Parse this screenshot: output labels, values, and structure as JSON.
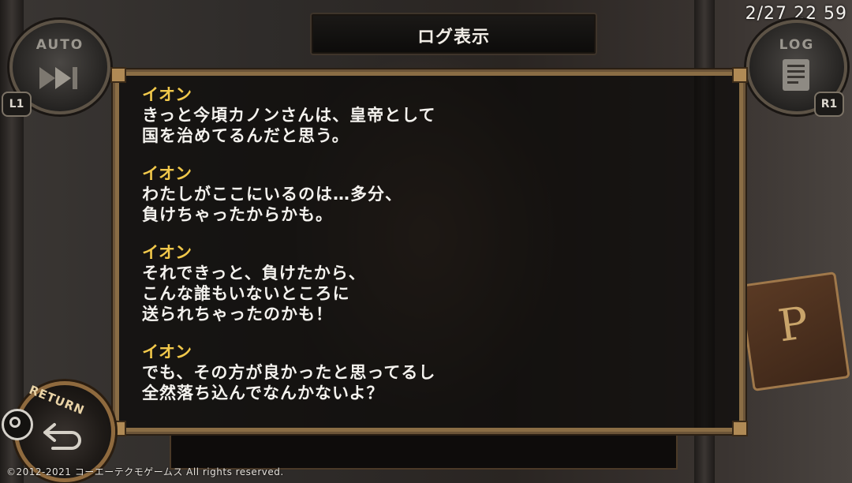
{
  "title": "ログ表示",
  "clock": "2/27 22 59",
  "buttons": {
    "auto_label": "AUTO",
    "auto_shoulder": "L1",
    "log_label": "LOG",
    "log_shoulder": "R1",
    "return_label": "RETURN"
  },
  "log_entries": [
    {
      "speaker": "イオン",
      "lines": [
        "きっと今頃カノンさんは、皇帝として",
        "国を治めてるんだと思う。"
      ]
    },
    {
      "speaker": "イオン",
      "lines": [
        "わたしがここにいるのは…多分、",
        "負けちゃったからかも。"
      ]
    },
    {
      "speaker": "イオン",
      "lines": [
        "それできっと、負けたから、",
        "こんな誰もいないところに",
        "送られちゃったのかも！"
      ]
    },
    {
      "speaker": "イオン",
      "lines": [
        "でも、その方が良かったと思ってるし",
        "全然落ち込んでなんかないよ？"
      ]
    }
  ],
  "copyright": "©2012-2021 コーエーテクモゲームス All rights reserved.",
  "colors": {
    "speaker": "#f1c84b",
    "text": "#f4f2ee",
    "frame": "#8a6d45"
  },
  "icons": {
    "auto": "fast-forward-icon",
    "log": "log-document-icon",
    "return": "return-arrow-icon",
    "confirm": "circle-button-icon"
  }
}
